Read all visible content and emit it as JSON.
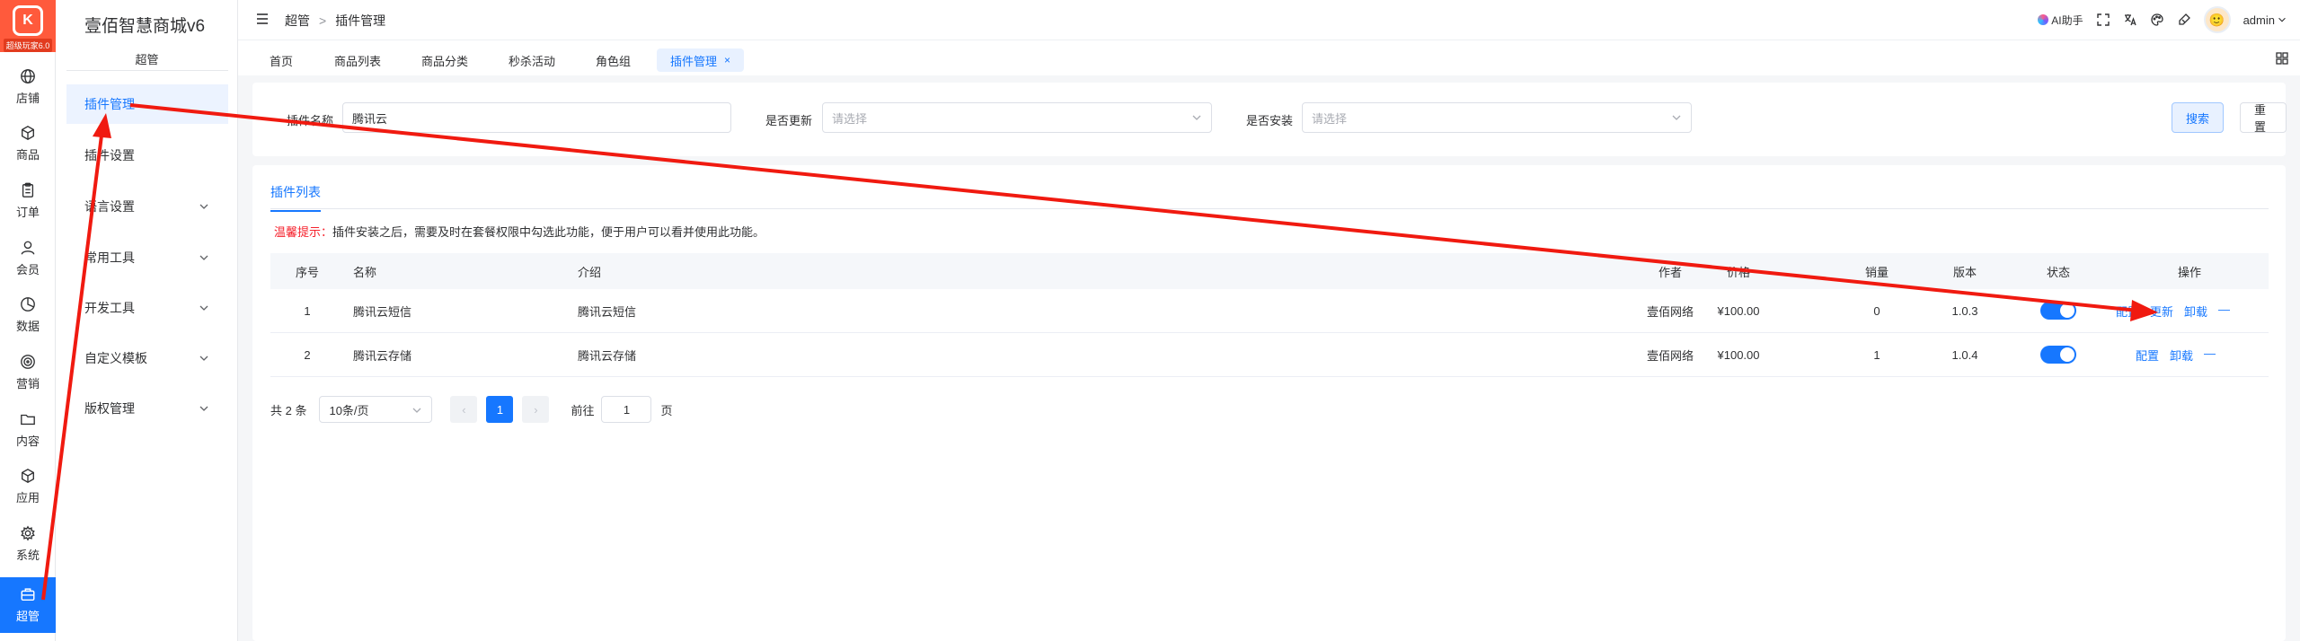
{
  "logo": {
    "badge": "超级玩家6.0",
    "mark": "K"
  },
  "rail": [
    {
      "label": "店铺",
      "icon": "globe-icon"
    },
    {
      "label": "商品",
      "icon": "cube-icon"
    },
    {
      "label": "订单",
      "icon": "clipboard-icon"
    },
    {
      "label": "会员",
      "icon": "user-icon"
    },
    {
      "label": "数据",
      "icon": "pie-chart-icon"
    },
    {
      "label": "营销",
      "icon": "target-icon"
    },
    {
      "label": "内容",
      "icon": "folder-icon"
    },
    {
      "label": "应用",
      "icon": "box-icon"
    },
    {
      "label": "系统",
      "icon": "gear-icon"
    },
    {
      "label": "超管",
      "icon": "briefcase-icon",
      "active": true
    }
  ],
  "brand": "壹佰智慧商城v6",
  "submenu": {
    "section": "超管",
    "items": [
      {
        "label": "插件管理",
        "active": true
      },
      {
        "label": "插件设置"
      },
      {
        "label": "语言设置",
        "expandable": true
      },
      {
        "label": "常用工具",
        "expandable": true
      },
      {
        "label": "开发工具",
        "expandable": true
      },
      {
        "label": "自定义模板",
        "expandable": true
      },
      {
        "label": "版权管理",
        "expandable": true
      }
    ]
  },
  "breadcrumb": {
    "root": "超管",
    "sep": ">",
    "current": "插件管理"
  },
  "header": {
    "ai_label": "AI助手",
    "username": "admin"
  },
  "tabs": [
    {
      "label": "首页"
    },
    {
      "label": "商品列表"
    },
    {
      "label": "商品分类"
    },
    {
      "label": "秒杀活动"
    },
    {
      "label": "角色组"
    },
    {
      "label": "插件管理",
      "active": true,
      "close": "×"
    }
  ],
  "filter": {
    "name_label": "插件名称",
    "name_value": "腾讯云",
    "update_label": "是否更新",
    "update_placeholder": "请选择",
    "install_label": "是否安装",
    "install_placeholder": "请选择",
    "search_btn": "搜索",
    "reset_btn": "重置"
  },
  "list": {
    "tab": "插件列表",
    "tip_prefix": "温馨提示：",
    "tip_text": "插件安装之后，需要及时在套餐权限中勾选此功能，便于用户可以看并使用此功能。",
    "columns": {
      "index": "序号",
      "name": "名称",
      "intro": "介绍",
      "author": "作者",
      "price": "价格",
      "sales": "销量",
      "version": "版本",
      "status": "状态",
      "actions": "操作"
    },
    "rows": [
      {
        "index": "1",
        "name": "腾讯云短信",
        "intro": "腾讯云短信",
        "author": "壹佰网络",
        "price": "¥100.00",
        "sales": "0",
        "version": "1.0.3",
        "status": true,
        "actions": [
          "配置",
          "更新",
          "卸载",
          "—"
        ]
      },
      {
        "index": "2",
        "name": "腾讯云存储",
        "intro": "腾讯云存储",
        "author": "壹佰网络",
        "price": "¥100.00",
        "sales": "1",
        "version": "1.0.4",
        "status": true,
        "actions": [
          "配置",
          "卸载",
          "—"
        ]
      }
    ]
  },
  "pagination": {
    "total": "共 2 条",
    "page_size": "10条/页",
    "prev": "‹",
    "current": "1",
    "next": "›",
    "goto_label": "前往",
    "goto_value": "1",
    "unit": "页"
  },
  "colors": {
    "accent": "#1677ff",
    "annotation": "#f01a10",
    "logo": "#ff5a3c"
  }
}
